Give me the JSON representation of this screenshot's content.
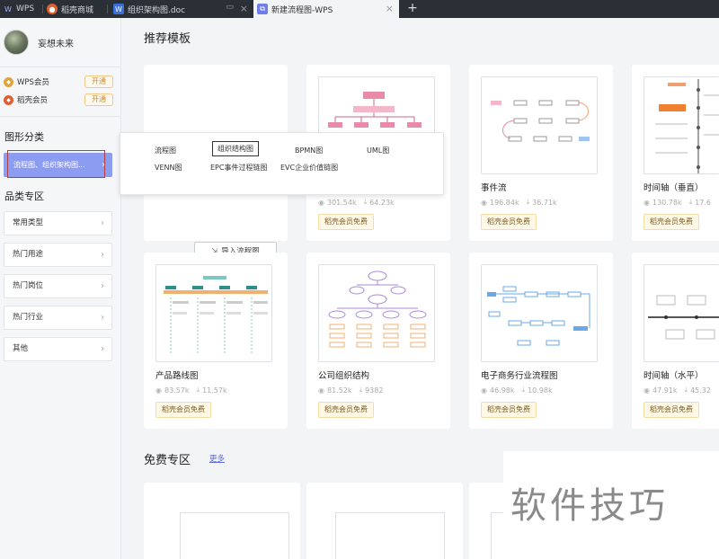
{
  "tabs": [
    {
      "label": "WPS",
      "icon": "wps-icon"
    },
    {
      "label": "稻壳商城",
      "icon": "docer-icon"
    },
    {
      "label": "组织架构图.doc",
      "icon": "word-icon"
    },
    {
      "label": "新建流程图-WPS",
      "icon": "flowchart-icon"
    }
  ],
  "user": {
    "name": "妄想未来"
  },
  "memberships": [
    {
      "label": "WPS会员",
      "action": "开通",
      "color": "#e0a43a"
    },
    {
      "label": "稻壳会员",
      "action": "开通",
      "color": "#e0602f"
    }
  ],
  "sidebar": {
    "shape_category_title": "图形分类",
    "selected_category": "流程图、组织架构图...",
    "product_section_title": "品类专区",
    "items": [
      "常用类型",
      "热门用途",
      "热门岗位",
      "热门行业",
      "其他"
    ]
  },
  "main": {
    "recommend_title": "推荐模板"
  },
  "popup": {
    "row1": [
      "流程图",
      "组织结构图",
      "BPMN图",
      "UML图"
    ],
    "row2": [
      "VENN图",
      "EPC事件过程链图",
      "EVC企业价值链图"
    ]
  },
  "blank": {
    "import_label": "导入流程图"
  },
  "templates": [
    {
      "title": "",
      "views": "301.54k",
      "downloads": "64.23k",
      "badge": "稻壳会员免费"
    },
    {
      "title": "事件流",
      "views": "196.84k",
      "downloads": "36.71k",
      "badge": "稻壳会员免费"
    },
    {
      "title": "时间轴（垂直）",
      "views": "130.78k",
      "downloads": "17.6",
      "badge": "稻壳会员免费"
    },
    {
      "title": "产品路线图",
      "views": "83.57k",
      "downloads": "11.57k",
      "badge": "稻壳会员免费"
    },
    {
      "title": "公司组织结构",
      "views": "81.52k",
      "downloads": "9382",
      "badge": "稻壳会员免费"
    },
    {
      "title": "电子商务行业流程图",
      "views": "46.98k",
      "downloads": "10.98k",
      "badge": "稻壳会员免费"
    },
    {
      "title": "时间轴（水平）",
      "views": "47.91k",
      "downloads": "45.32",
      "badge": "稻壳会员免费"
    }
  ],
  "free": {
    "title": "免费专区",
    "more": "更多"
  },
  "watermark": {
    "text": "软件技巧"
  },
  "colors": {
    "accent": "#8c9cf0",
    "tabbar": "#2b2f36",
    "badge_bg": "#fff8e6"
  }
}
